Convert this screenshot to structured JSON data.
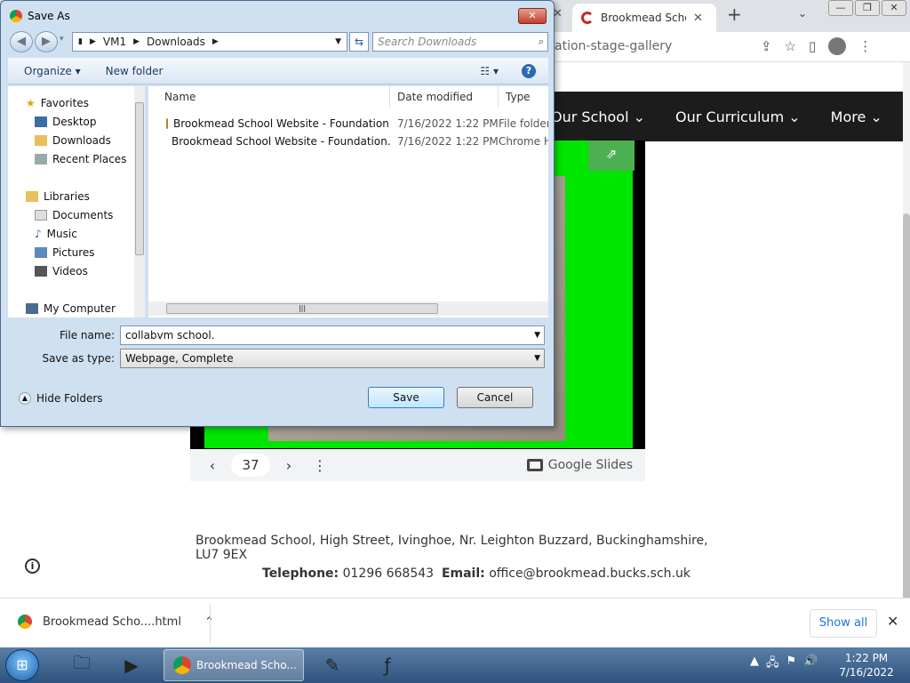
{
  "browser": {
    "tab_title": "Brookmead Scho",
    "url_fragment": "ation-stage-gallery"
  },
  "site": {
    "nav": [
      "Our School",
      "Our Curriculum",
      "More"
    ],
    "slide_number": "37",
    "slides_brand": "Google Slides",
    "address": "Brookmead School, High Street, Ivinghoe, Nr. Leighton Buzzard, Buckinghamshire, LU7 9EX",
    "telephone_label": "Telephone:",
    "telephone": "01296 668543",
    "email_label": "Email:",
    "email": "office@brookmead.bucks.sch.uk"
  },
  "download_bar": {
    "file": "Brookmead Scho....html",
    "show_all": "Show all"
  },
  "dialog": {
    "title": "Save As",
    "path": [
      "VM1",
      "Downloads"
    ],
    "search_placeholder": "Search Downloads",
    "organize": "Organize",
    "new_folder": "New folder",
    "nav": {
      "favorites": "Favorites",
      "desktop": "Desktop",
      "downloads": "Downloads",
      "recent": "Recent Places",
      "libraries": "Libraries",
      "documents": "Documents",
      "music": "Music",
      "pictures": "Pictures",
      "videos": "Videos",
      "computer": "My Computer"
    },
    "columns": {
      "name": "Name",
      "date": "Date modified",
      "type": "Type"
    },
    "files": [
      {
        "name": "Brookmead School Website - Foundation...",
        "date": "7/16/2022 1:22 PM",
        "type": "File folder"
      },
      {
        "name": "Brookmead School Website - Foundation...",
        "date": "7/16/2022 1:22 PM",
        "type": "Chrome H"
      }
    ],
    "file_name_label": "File name:",
    "file_name": "collabvm school.",
    "save_type_label": "Save as type:",
    "save_type": "Webpage, Complete",
    "hide_folders": "Hide Folders",
    "save": "Save",
    "cancel": "Cancel"
  },
  "taskbar": {
    "active_label": "Brookmead Scho...",
    "time": "1:22 PM",
    "date": "7/16/2022"
  },
  "colors": {
    "slide_green": "#00e600",
    "nav_bg": "#1c1c1c"
  }
}
